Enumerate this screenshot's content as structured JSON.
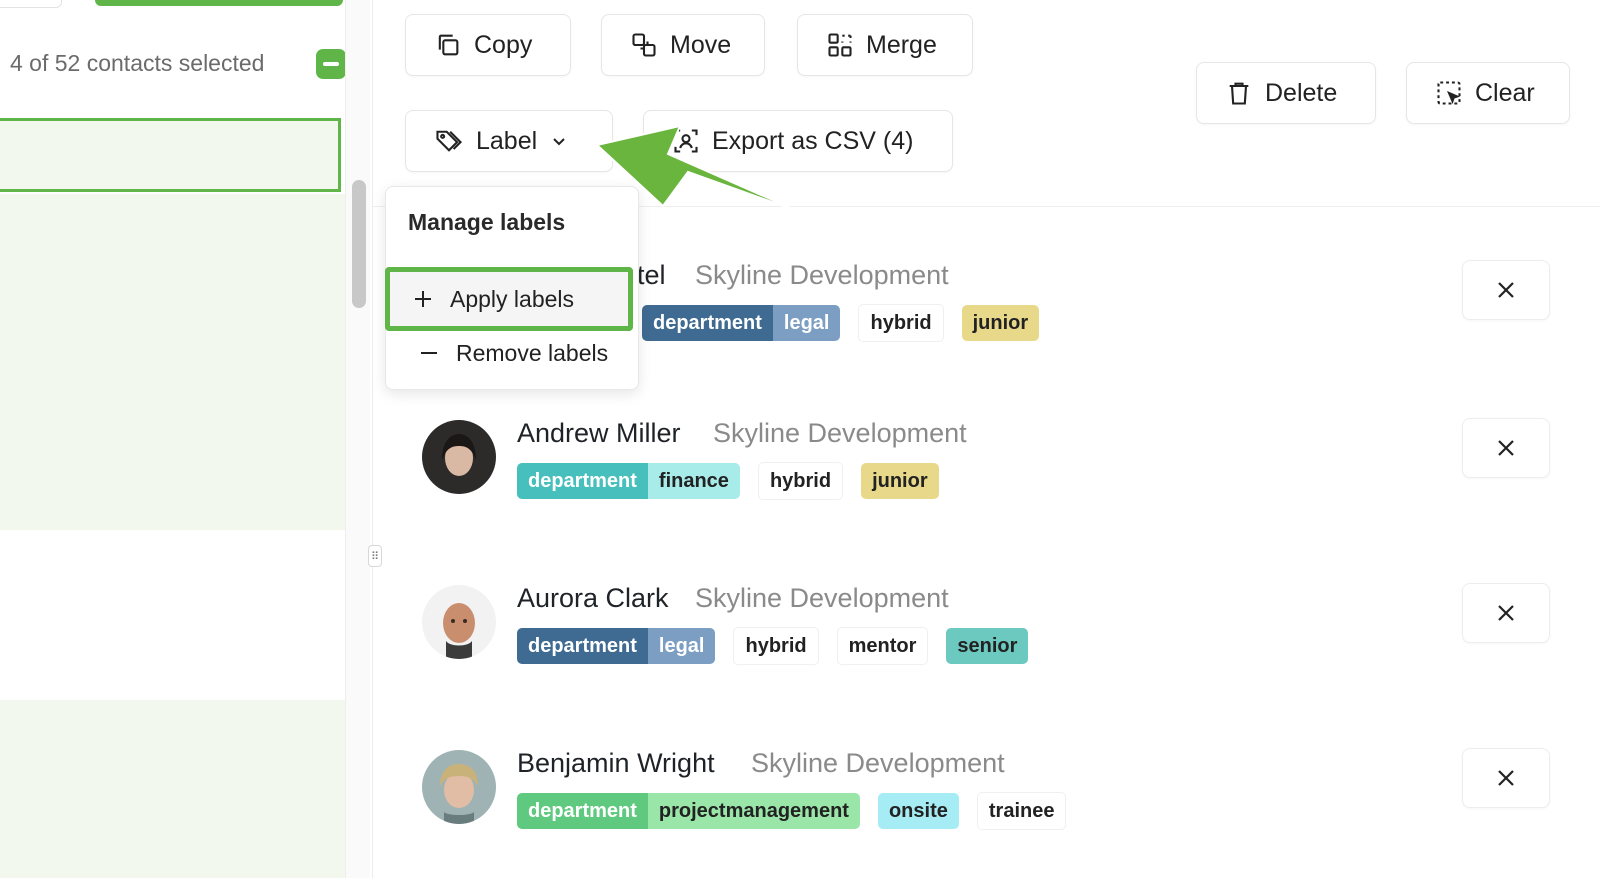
{
  "sidebar": {
    "selection_text": "4 of 52 contacts selected"
  },
  "toolbar": {
    "copy_label": "Copy",
    "move_label": "Move",
    "merge_label": "Merge",
    "delete_label": "Delete",
    "clear_label": "Clear",
    "label_label": "Label",
    "export_label": "Export as CSV (4)"
  },
  "label_menu": {
    "heading": "Manage labels",
    "apply_label": "Apply labels",
    "remove_label": "Remove labels"
  },
  "contacts": [
    {
      "name_visible": "atel",
      "company": "Skyline Development",
      "dept_key": "department",
      "dept_value": "legal",
      "tags": [
        "hybrid",
        "junior"
      ]
    },
    {
      "name": "Andrew Miller",
      "company": "Skyline Development",
      "dept_key": "department",
      "dept_value": "finance",
      "tags": [
        "hybrid",
        "junior"
      ]
    },
    {
      "name": "Aurora Clark",
      "company": "Skyline Development",
      "dept_key": "department",
      "dept_value": "legal",
      "tags": [
        "hybrid",
        "mentor",
        "senior"
      ]
    },
    {
      "name": "Benjamin Wright",
      "company": "Skyline Development",
      "dept_key": "department",
      "dept_value": "projectmanagement",
      "tags": [
        "onsite",
        "trainee"
      ]
    }
  ],
  "colors": {
    "accent_green": "#5fb548",
    "legal_key": "#3f6a91",
    "legal_value": "#7c9ec3",
    "finance_key": "#47bfbd",
    "finance_value": "#a7ece9",
    "pm_key": "#5fca7f",
    "pm_value": "#9ae6a9",
    "junior": "#e8d98a",
    "senior": "#6cc9bf",
    "onsite": "#a5ecf5"
  }
}
